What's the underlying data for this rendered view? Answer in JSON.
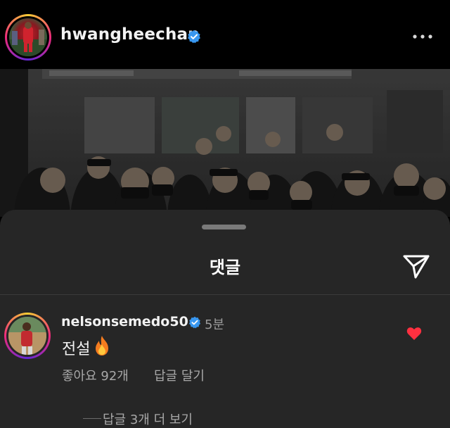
{
  "post_header": {
    "username": "hwangheechan",
    "verified": true,
    "more_icon": "more-horizontal-icon"
  },
  "post_image": {
    "description_icon": "crowd-photo"
  },
  "comments_sheet": {
    "title": "댓글",
    "share_icon": "send-icon",
    "comments": [
      {
        "username": "nelsonsemedo50",
        "verified": true,
        "time": "5분",
        "text": "전설",
        "emoji": "fire-icon",
        "likes_label": "좋아요 92개",
        "reply_label": "답글 달기",
        "liked": true,
        "view_replies_label": "답글 3개 더 보기"
      }
    ]
  },
  "colors": {
    "background": "#000000",
    "sheet": "#262626",
    "verified_blue": "#3897f0",
    "heart_red": "#ff3040",
    "muted_text": "#a8a8a8"
  }
}
